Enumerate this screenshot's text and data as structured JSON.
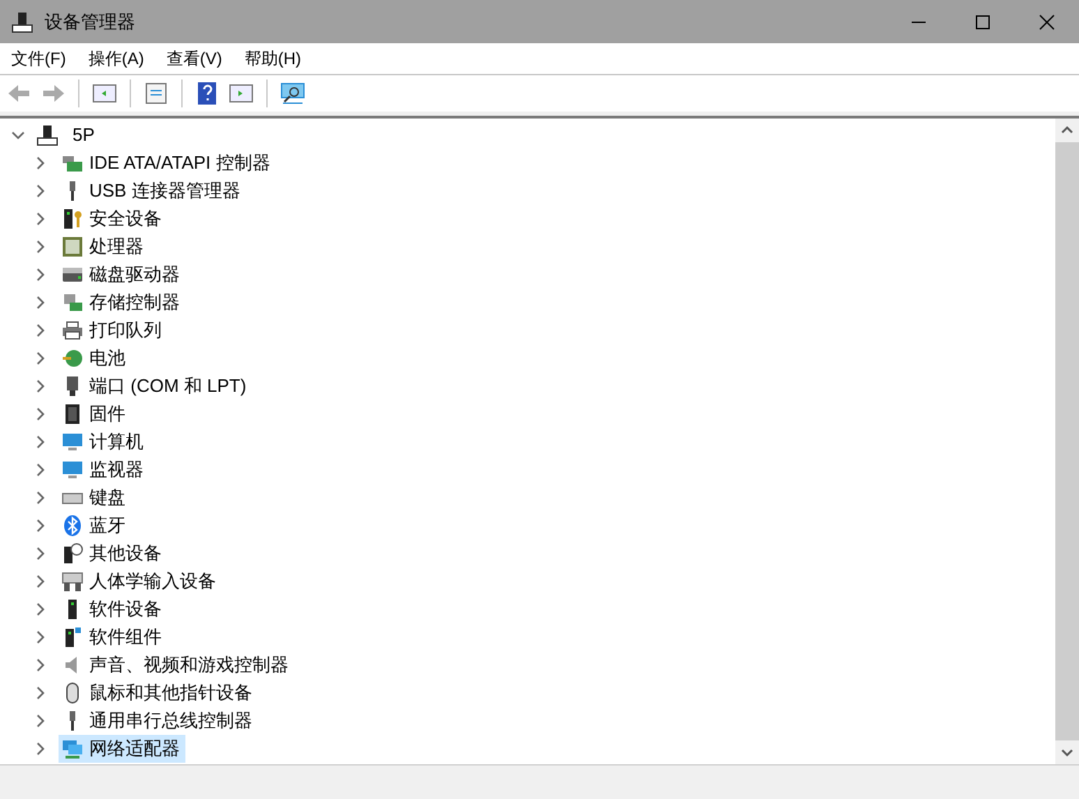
{
  "window": {
    "title": "设备管理器"
  },
  "menu": [
    "文件(F)",
    "操作(A)",
    "查看(V)",
    "帮助(H)"
  ],
  "tree": {
    "label": "5P",
    "expanded": true,
    "children": [
      {
        "label": "IDE ATA/ATAPI 控制器",
        "expanded": false,
        "selected": false
      },
      {
        "label": "USB 连接器管理器",
        "expanded": false,
        "selected": false
      },
      {
        "label": "安全设备",
        "expanded": false,
        "selected": false
      },
      {
        "label": "处理器",
        "expanded": false,
        "selected": false
      },
      {
        "label": "磁盘驱动器",
        "expanded": false,
        "selected": false
      },
      {
        "label": "存储控制器",
        "expanded": false,
        "selected": false
      },
      {
        "label": "打印队列",
        "expanded": false,
        "selected": false
      },
      {
        "label": "电池",
        "expanded": false,
        "selected": false
      },
      {
        "label": "端口 (COM 和 LPT)",
        "expanded": false,
        "selected": false
      },
      {
        "label": "固件",
        "expanded": false,
        "selected": false
      },
      {
        "label": "计算机",
        "expanded": false,
        "selected": false
      },
      {
        "label": "监视器",
        "expanded": false,
        "selected": false
      },
      {
        "label": "键盘",
        "expanded": false,
        "selected": false
      },
      {
        "label": "蓝牙",
        "expanded": false,
        "selected": false
      },
      {
        "label": "其他设备",
        "expanded": false,
        "selected": false
      },
      {
        "label": "人体学输入设备",
        "expanded": false,
        "selected": false
      },
      {
        "label": "软件设备",
        "expanded": false,
        "selected": false
      },
      {
        "label": "软件组件",
        "expanded": false,
        "selected": false
      },
      {
        "label": "声音、视频和游戏控制器",
        "expanded": false,
        "selected": false
      },
      {
        "label": "鼠标和其他指针设备",
        "expanded": false,
        "selected": false
      },
      {
        "label": "通用串行总线控制器",
        "expanded": false,
        "selected": false
      },
      {
        "label": "网络适配器",
        "expanded": false,
        "selected": true
      }
    ]
  }
}
